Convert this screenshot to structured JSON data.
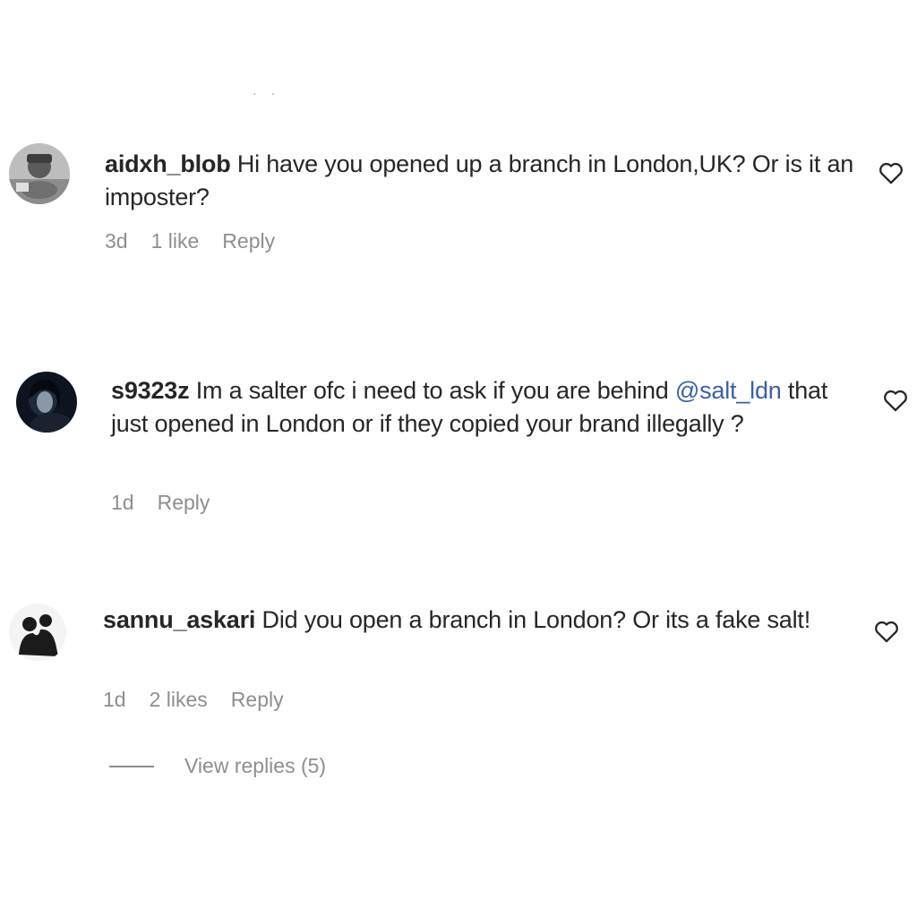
{
  "comments": [
    {
      "username": "aidxh_blob",
      "text": "Hi have you opened up a branch in London,UK? Or is it an imposter?",
      "time": "3d",
      "likes": "1 like",
      "reply_label": "Reply"
    },
    {
      "username": "s9323z",
      "text_before": "Im a salter ofc i need to ask if you are behind",
      "mention": "@salt_ldn",
      "text_after": "that just opened in London or if they copied your brand illegally ?",
      "time": "1d",
      "reply_label": "Reply"
    },
    {
      "username": "sannu_askari",
      "text": "Did you open a branch in London? Or its a fake salt!",
      "time": "1d",
      "likes": "2 likes",
      "reply_label": "Reply"
    }
  ],
  "view_replies": "View replies (5)",
  "colors": {
    "text": "#262626",
    "meta": "#8e8e8e",
    "mention": "#3a5fa8"
  },
  "icons": {
    "like": "heart-outline-icon"
  }
}
